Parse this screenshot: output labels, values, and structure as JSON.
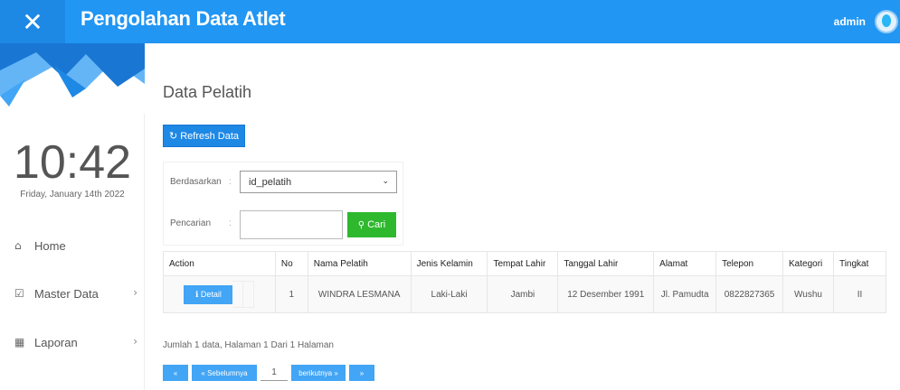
{
  "header": {
    "close_glyph": "✕",
    "title": "Pengolahan Data Atlet",
    "user": "admin"
  },
  "sidebar": {
    "clock": "10:42",
    "date": "Friday, January 14th 2022",
    "items": [
      {
        "label": "Home",
        "icon": "home-icon",
        "glyph": "⌂"
      },
      {
        "label": "Master Data",
        "icon": "edit-icon",
        "glyph": "☑",
        "chevron": "›"
      },
      {
        "label": "Laporan",
        "icon": "calendar-icon",
        "glyph": "▦",
        "chevron": "›"
      }
    ]
  },
  "main": {
    "page_title": "Data Pelatih",
    "refresh_label": "Refresh Data",
    "refresh_glyph": "↻",
    "filter": {
      "by_label": "Berdasarkan",
      "colon": ":",
      "by_value": "id_pelatih",
      "caret": "⌄",
      "search_label": "Pencarian",
      "search_value": "",
      "search_button": "Cari",
      "search_glyph": "⚲"
    },
    "table": {
      "headers": [
        "Action",
        "No",
        "Nama Pelatih",
        "Jenis Kelamin",
        "Tempat Lahir",
        "Tanggal Lahir",
        "Alamat",
        "Telepon",
        "Kategori",
        "Tingkat"
      ],
      "rows": [
        {
          "detail_label": "ℹ Detail",
          "no": "1",
          "nama": "WINDRA LESMANA",
          "jenis_kelamin": "Laki-Laki",
          "tempat_lahir": "Jambi",
          "tanggal_lahir": "12 Desember 1991",
          "alamat": "Jl. Pamudta",
          "telepon": "0822827365",
          "kategori": "Wushu",
          "tingkat": "II"
        }
      ]
    },
    "summary": "Jumlah 1 data, Halaman 1 Dari 1 Halaman",
    "pager": {
      "first": "«",
      "prev": "« Sebelumnya",
      "page": "1",
      "next": "berikutnya »",
      "last": "»"
    }
  },
  "colors": {
    "topbar": "#2196f3",
    "primary_button": "#1e88e5",
    "search_button": "#2eb82e"
  }
}
